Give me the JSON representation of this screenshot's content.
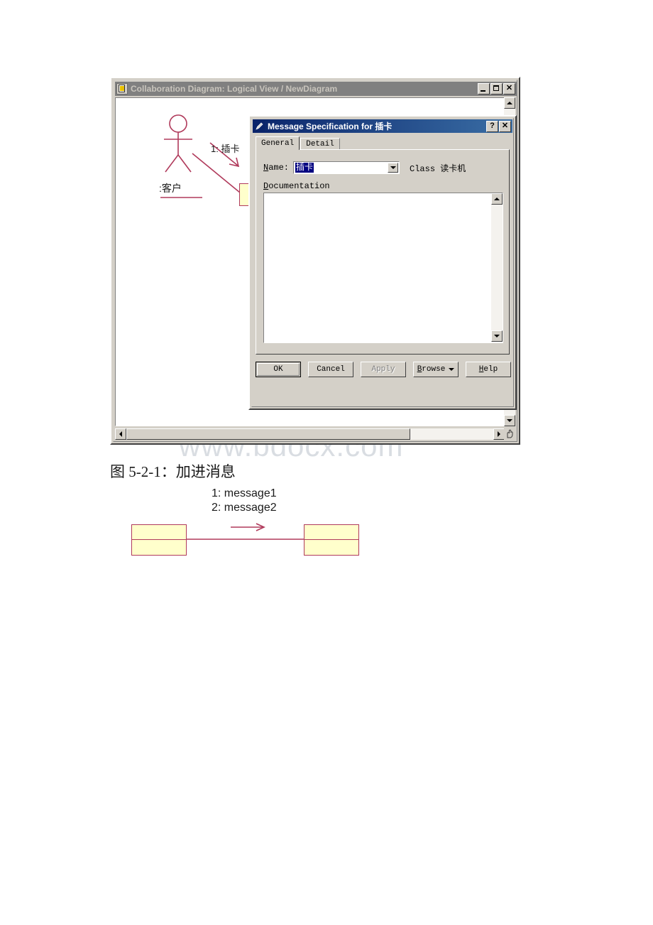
{
  "watermark": {
    "text": "www.bdocx.com"
  },
  "mdi_window": {
    "title": "Collaboration Diagram: Logical View / NewDiagram",
    "sysicon": "diagram-document-icon",
    "controls": {
      "minimize": "_",
      "maximize": "□",
      "close": "✕"
    },
    "diagram": {
      "actor_label": ":客户",
      "message_label": "1: 插卡"
    }
  },
  "dialog": {
    "title": "Message Specification for 插卡",
    "sysicon": "message-spec-icon",
    "titlebar_buttons": {
      "help": "?",
      "close": "✕"
    },
    "tabs": [
      {
        "label": "General",
        "active": true
      },
      {
        "label": "Detail",
        "active": false
      }
    ],
    "general": {
      "name_label": "Name:",
      "name_mnemonic": "N",
      "name_value": "插卡",
      "name_placeholder": "",
      "dropdown_icon": "chevron-down-icon",
      "class_label": "Class 读卡机",
      "documentation_label": "Documentation",
      "documentation_mnemonic": "D",
      "documentation_value": ""
    },
    "buttons": [
      {
        "label": "OK",
        "state": "default",
        "mnemonic": ""
      },
      {
        "label": "Cancel",
        "state": "normal",
        "mnemonic": ""
      },
      {
        "label": "Apply",
        "state": "disabled",
        "mnemonic": "A"
      },
      {
        "label": "Browse",
        "state": "normal",
        "mnemonic": "B",
        "has_dropdown": true
      },
      {
        "label": "Help",
        "state": "normal",
        "mnemonic": "H"
      }
    ]
  },
  "caption": {
    "text": "图 5-2-1：加进消息"
  },
  "bottom_diagram": {
    "messages": [
      "1: message1",
      "2: message2"
    ],
    "colors": {
      "box_fill": "#ffffcc",
      "box_border": "#b03a5b",
      "link": "#b03a5b"
    }
  }
}
